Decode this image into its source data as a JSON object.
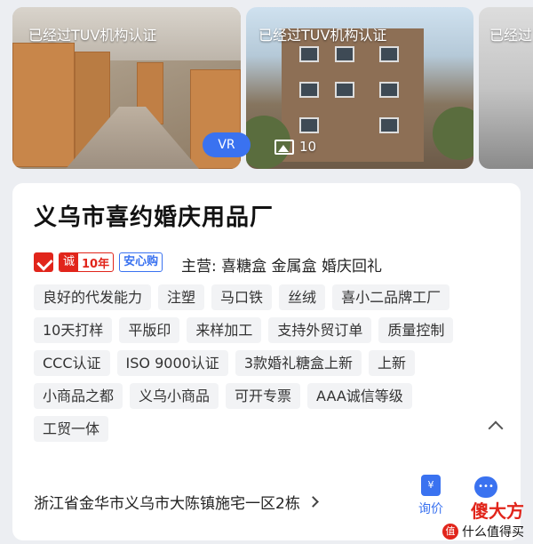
{
  "gallery": {
    "images": [
      {
        "cert": "已经过TUV机构认证",
        "badge": "VR"
      },
      {
        "cert": "已经过TUV机构认证",
        "photo_count": "10"
      },
      {
        "cert": "已经过"
      }
    ]
  },
  "card": {
    "title": "义乌市喜约婚庆用品厂",
    "badges": {
      "cheng": "诚",
      "years": "10年",
      "anxin": "安心购"
    },
    "main_business": "主营: 喜糖盒 金属盒 婚庆回礼",
    "tag_rows": [
      [
        "良好的代发能力",
        "注塑",
        "马口铁",
        "丝绒",
        "喜小二品牌工厂"
      ],
      [
        "10天打样",
        "平版印",
        "来样加工",
        "支持外贸订单",
        "质量控制"
      ],
      [
        "CCC认证",
        "ISO 9000认证",
        "3款婚礼糖盒上新",
        "上新"
      ],
      [
        "小商品之都",
        "义乌小商品",
        "可开专票",
        "AAA诚信等级"
      ],
      [
        "工贸一体"
      ]
    ],
    "address": "浙江省金华市义乌市大陈镇施宅一区2栋",
    "inquiry_label": "询价",
    "inquiry_icon_glyph": "¥"
  },
  "watermark": {
    "top": "傻大方",
    "bottom": "什么值得买",
    "logo_glyph": "值"
  },
  "colors": {
    "accent_blue": "#3a72f0",
    "brand_red": "#e1251b"
  }
}
